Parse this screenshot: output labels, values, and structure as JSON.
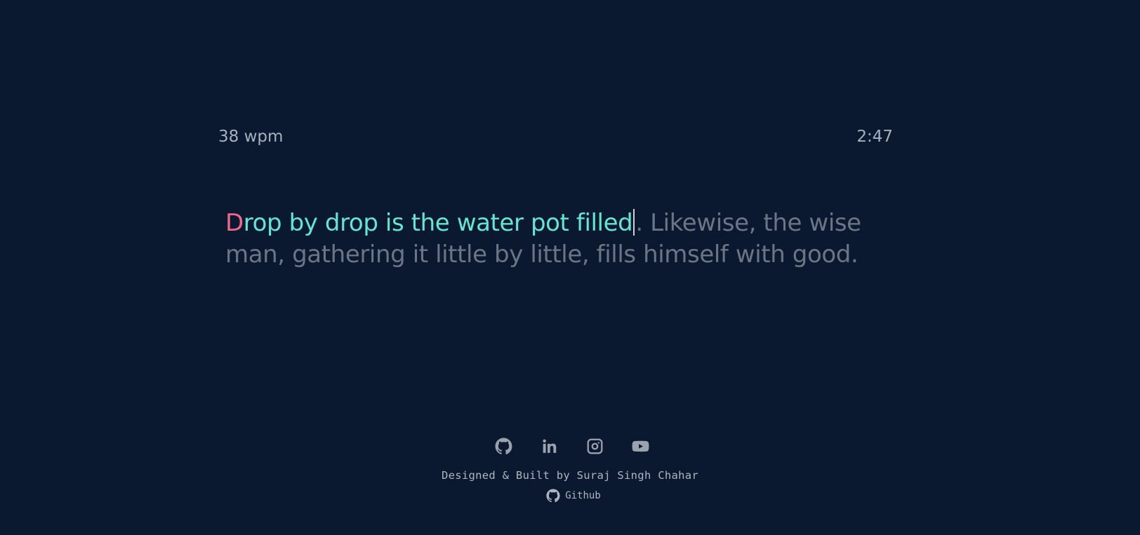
{
  "stats": {
    "wpm": "38 wpm",
    "timer": "2:47"
  },
  "quote": {
    "error_char": "D",
    "correct_text": "rop by drop is the water pot filled",
    "remaining_text": ". Likewise, the wise man, gathering it little by little, fills himself with good."
  },
  "colors": {
    "background": "#0b1930",
    "correct": "#63e6d2",
    "error": "#f0668e",
    "pending": "#6c7585"
  },
  "footer": {
    "socials": [
      {
        "name": "github-icon"
      },
      {
        "name": "linkedin-icon"
      },
      {
        "name": "instagram-icon"
      },
      {
        "name": "youtube-icon"
      }
    ],
    "credit": "Designed & Built by Suraj Singh Chahar",
    "github_link": "Github"
  }
}
